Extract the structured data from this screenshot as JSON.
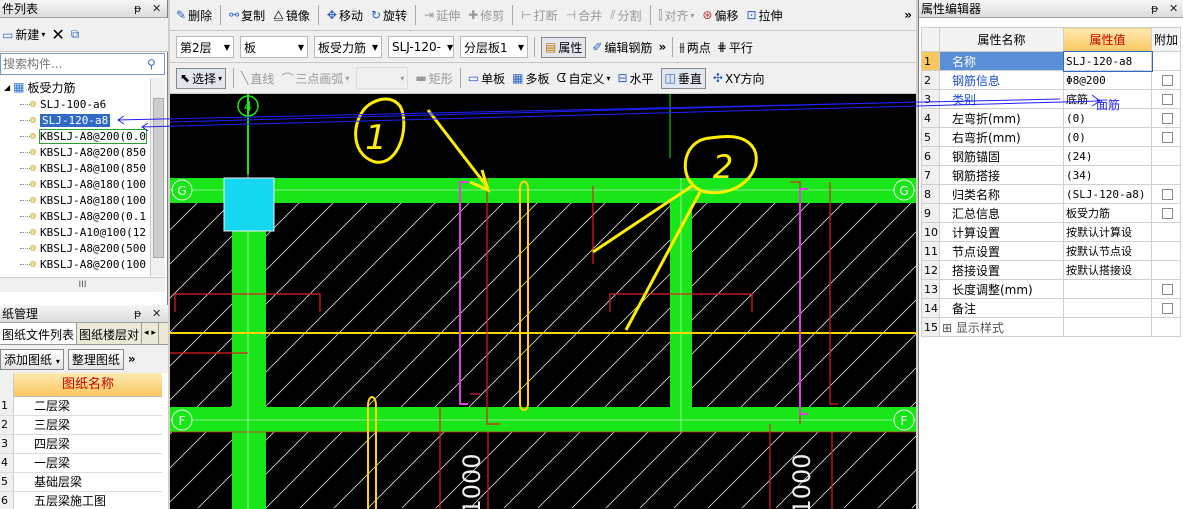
{
  "left": {
    "component_title": "件列表",
    "pin": "📌",
    "close": "✕",
    "new_label": "新建",
    "search_placeholder": "搜索构件...",
    "tree_root": "板受力筋",
    "tree_items": [
      "SLJ-100-a6",
      "SLJ-120-a8",
      "KBSLJ-A8@200(0.0",
      "KBSLJ-A8@200(850",
      "KBSLJ-A8@100(850",
      "KBSLJ-A8@180(100",
      "KBSLJ-A8@180(100",
      "KBSLJ-A8@200(0.1",
      "KBSLJ-A10@100(12",
      "KBSLJ-A8@200(500",
      "KBSLJ-A8@200(100",
      "KBSLJ-A8@200(500"
    ],
    "hscroll_glyph": "III",
    "drawing_title": "纸管理",
    "drawing_tabs": [
      "图纸文件列表",
      "图纸楼层对"
    ],
    "add_drawing": "添加图纸",
    "organize_drawing": "整理图纸",
    "more": "»",
    "table_header": "图纸名称",
    "drawings": [
      "二层梁",
      "三层梁",
      "四层梁",
      "一层梁",
      "基础层梁",
      "五层梁施工图"
    ]
  },
  "toolbar": {
    "row1": {
      "delete": "删除",
      "copy": "复制",
      "mirror": "镜像",
      "move": "移动",
      "rotate": "旋转",
      "extend": "延伸",
      "trim": "修剪",
      "break": "打断",
      "merge": "合并",
      "split": "分割",
      "align": "对齐",
      "offset": "偏移",
      "stretch": "拉伸"
    },
    "row2": {
      "floor": "第2层",
      "type": "板",
      "subtype": "板受力筋",
      "component": "SLJ-120-",
      "layer": "分层板1",
      "property": "属性",
      "edit_rebar": "编辑钢筋",
      "two_points": "两点",
      "parallel": "平行"
    },
    "row3": {
      "select": "选择",
      "line": "直线",
      "arc": "三点画弧",
      "rect": "矩形",
      "single_slab": "单板",
      "multi_slab": "多板",
      "custom": "自定义",
      "horizontal": "水平",
      "vertical": "垂直",
      "xy_dir": "XY方向"
    },
    "more": "»"
  },
  "canvas": {
    "axis_top": "4",
    "axis_left_g": "G",
    "axis_left_f": "F",
    "axis_right_g": "G",
    "axis_right_f": "F",
    "dim1": "1000",
    "dim2": "1000",
    "annotation_1": "1",
    "annotation_2": "2",
    "overlay_label": "面筋"
  },
  "props": {
    "title": "属性编辑器",
    "col_name": "属性名称",
    "col_value": "属性值",
    "col_extra": "附加",
    "rows": [
      {
        "idx": "1",
        "name": "名称",
        "value": "SLJ-120-a8",
        "cb": false
      },
      {
        "idx": "2",
        "name": "钢筋信息",
        "value": "Φ8@200",
        "cb": true
      },
      {
        "idx": "3",
        "name": "类别",
        "value": "底筋",
        "cb": true
      },
      {
        "idx": "4",
        "name": "左弯折(mm)",
        "value": "(0)",
        "cb": true
      },
      {
        "idx": "5",
        "name": "右弯折(mm)",
        "value": "(0)",
        "cb": true
      },
      {
        "idx": "6",
        "name": "钢筋锚固",
        "value": "(24)",
        "cb": false
      },
      {
        "idx": "7",
        "name": "钢筋搭接",
        "value": "(34)",
        "cb": false
      },
      {
        "idx": "8",
        "name": "归类名称",
        "value": "(SLJ-120-a8)",
        "cb": true
      },
      {
        "idx": "9",
        "name": "汇总信息",
        "value": "板受力筋",
        "cb": true
      },
      {
        "idx": "10",
        "name": "计算设置",
        "value": "按默认计算设",
        "cb": false
      },
      {
        "idx": "11",
        "name": "节点设置",
        "value": "按默认节点设",
        "cb": false
      },
      {
        "idx": "12",
        "name": "搭接设置",
        "value": "按默认搭接设",
        "cb": false
      },
      {
        "idx": "13",
        "name": "长度调整(mm)",
        "value": "",
        "cb": true
      },
      {
        "idx": "14",
        "name": "备注",
        "value": "",
        "cb": true
      },
      {
        "idx": "15",
        "name": "显示样式",
        "value": "",
        "cb": false
      }
    ]
  }
}
